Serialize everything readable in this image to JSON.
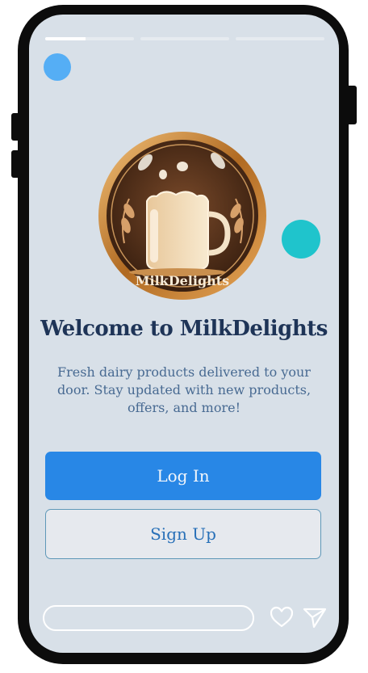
{
  "story": {
    "segments": [
      {
        "progress": 0.45
      },
      {
        "progress": 0
      },
      {
        "progress": 0
      }
    ]
  },
  "logo": {
    "brand_text": "MilkDelights"
  },
  "welcome": {
    "title": "Welcome to MilkDelights",
    "description": "Fresh dairy products delivered to your door. Stay updated with new products, offers, and more!"
  },
  "actions": {
    "login_label": "Log In",
    "signup_label": "Sign Up"
  },
  "footer": {
    "icons": [
      "heart-icon",
      "send-icon"
    ]
  },
  "colors": {
    "background": "#d8e0e8",
    "primary": "#2887e6",
    "title": "#1e3457",
    "teal_accent": "#1fc4cc",
    "avatar": "#55aef5"
  }
}
